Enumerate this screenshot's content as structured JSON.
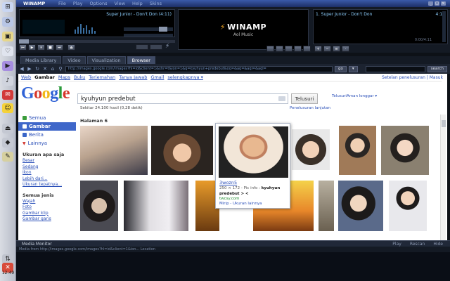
{
  "window": {
    "app_name": "WINAMP",
    "menu": [
      "File",
      "Play",
      "Options",
      "View",
      "Help",
      "Skins"
    ]
  },
  "player": {
    "track": "Super Junior - Don't Don (4:11)",
    "logo_title": "WINAMP",
    "logo_sub": "Aol Music"
  },
  "playlist": {
    "item_title": "1. Super Junior - Don't Don",
    "item_time": "4:11",
    "total": "0:00/4:11"
  },
  "tabs": [
    "Media Library",
    "Video",
    "Visualization",
    "Browser"
  ],
  "browser": {
    "url": "http://images.google.com/images?hl=id&client=1&xhr=t&ion=1&q=kyuhyun+predebut&oq=&aq=&aqi=&aql=",
    "go_label": "go",
    "search_label": "search"
  },
  "google": {
    "nav_links": [
      "Web",
      "Gambar",
      "Maps",
      "Buku",
      "Terjemahan",
      "Tanya Jawab",
      "Gmail",
      "selengkapnya ▾"
    ],
    "account_links": "Setelan penelusuran | Masuk",
    "query": "kyuhyun predebut",
    "search_button": "Telusuri",
    "advanced_link": "Penelusuran lanjutan",
    "safesearch": "TelusuriAman longgar ▾",
    "results_stats": "Sekitar 24.100 hasil (0,28 detik)",
    "section_heading": "Halaman 6",
    "left_nav": [
      {
        "label": "Semua",
        "color": "#3b9d3b"
      },
      {
        "label": "Gambar",
        "color": "#ffffff"
      },
      {
        "label": "Berita",
        "color": "#3a66c8"
      },
      {
        "label": "Lainnya",
        "color": "#d0322a"
      }
    ],
    "size_heading": "Ukuran apa saja",
    "size_links": [
      "Besar",
      "Sedang",
      "Ikon",
      "Lebih dari...",
      "Ukuran tepatnya..."
    ],
    "type_heading": "Semua jenis",
    "type_links": [
      "Wajah",
      "Foto",
      "Gambar klip",
      "Gambar garis"
    ]
  },
  "tooltip": {
    "title": "3wozn5",
    "meta_size": "250 × 172 - Pic info :",
    "meta_bold": "kyuhyun",
    "desc": "predebut > <",
    "host": "twcsy.com",
    "links": "Mirip - Ukuran lainnya"
  },
  "monitor": {
    "title": "Media Monitor",
    "play": "Play",
    "rescan": "Rescan",
    "hide": "Hide",
    "status": "Media from http://images.google.com/images?hl=id&client=1&ion...     Location"
  },
  "clock": "12:49",
  "colors": {
    "accent": "#3f67c9",
    "link": "#2a4fb8",
    "frame": "#141a24"
  }
}
